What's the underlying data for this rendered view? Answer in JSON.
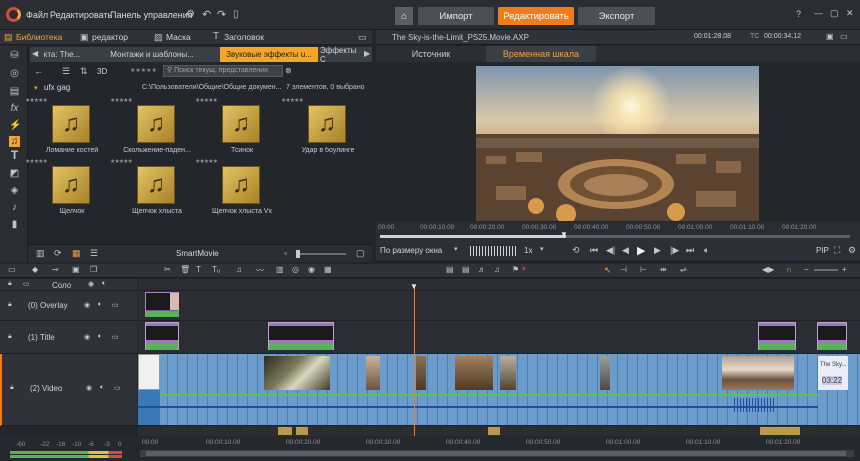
{
  "menu": {
    "items": [
      "Файл",
      "Редактировать",
      "Панель управления"
    ],
    "home_icon": "home-icon",
    "modes": [
      {
        "label": "Импорт",
        "active": false
      },
      {
        "label": "Редактировать",
        "active": true
      },
      {
        "label": "Экспорт",
        "active": false
      }
    ],
    "accent": "#f07d1a"
  },
  "library": {
    "top_tabs": [
      "Библиотека",
      "редактор",
      "Маска",
      "Заголовок"
    ],
    "category_tabs": [
      "кта: The...",
      "Монтажи и шаблоны...",
      "Звуковые эффекты u...",
      "Эффекты С"
    ],
    "search_placeholder": "Поиск текущ. представления",
    "view_3d": "3D",
    "folder_name": "ufx gag",
    "path": "C:\\Пользователи\\Общие\\Общие докумен...",
    "count": "7 элементов, 0 выбрано",
    "items": [
      "Ломание костей",
      "Скольжение-паден...",
      "Тсинок",
      "Удар в боулинге",
      "Щелчок",
      "Щелчок хлыста",
      "Щелчок хлыста Vx"
    ],
    "footer_label": "SmartMovie"
  },
  "preview": {
    "file_name": "The Sky-is-the-Limit_PS25.Movie.AXP",
    "time_current": "00:01:28.08",
    "tc_label": "TC",
    "time_total": "00:00:34.12",
    "tabs": [
      "Источник",
      "Временная шкала"
    ],
    "active_tab": 1,
    "ruler_labels": [
      "00:00",
      "00:00:10.00",
      "00:00:20.00",
      "00:00:30.00",
      "00:00:40.00",
      "00:00:50.00",
      "00:01:00.00",
      "00:01:10.00",
      "00:01:20.00"
    ],
    "fit_label": "По размеру окна",
    "speed": "1x",
    "pip": "PIP"
  },
  "timeline": {
    "solo_label": "Соло",
    "tracks": [
      "(0) Overlay",
      "(1) Title",
      "(2) Video"
    ],
    "ruler_labels": [
      "00:00",
      "00:00:10.00",
      "00:00:20.00",
      "00:00:30.00",
      "00:00:40.00",
      "00:00:50.00",
      "00:01:00.00",
      "00:01:10.00",
      "00:01:20.00"
    ],
    "clip_title": "The Sky...",
    "clip_time": "03:22",
    "meter_labels": [
      "-60",
      "-22",
      "-16",
      "-10",
      "-6",
      "-3",
      "0"
    ]
  }
}
